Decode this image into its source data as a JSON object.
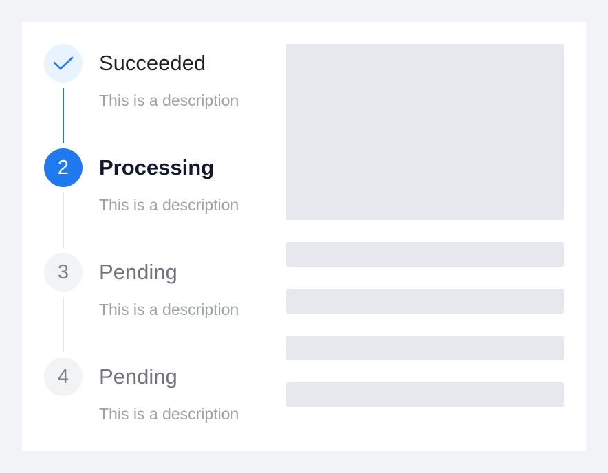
{
  "steps": [
    {
      "status": "finished",
      "icon": "check-icon",
      "number": "1",
      "title": "Succeeded",
      "description": "This is a description"
    },
    {
      "status": "active",
      "number": "2",
      "title": "Processing",
      "description": "This is a description"
    },
    {
      "status": "waiting",
      "number": "3",
      "title": "Pending",
      "description": "This is a description"
    },
    {
      "status": "waiting",
      "number": "4",
      "title": "Pending",
      "description": "This is a description"
    }
  ],
  "colors": {
    "primary": "#1f7aef",
    "primary_light": "#e8f3ff",
    "pending_bg": "#f2f3f5",
    "skeleton": "#e6e8ee",
    "page_bg": "#f2f3f7"
  },
  "skeleton_blocks": [
    "image-placeholder",
    "line-placeholder",
    "line-placeholder",
    "line-placeholder",
    "line-placeholder"
  ]
}
